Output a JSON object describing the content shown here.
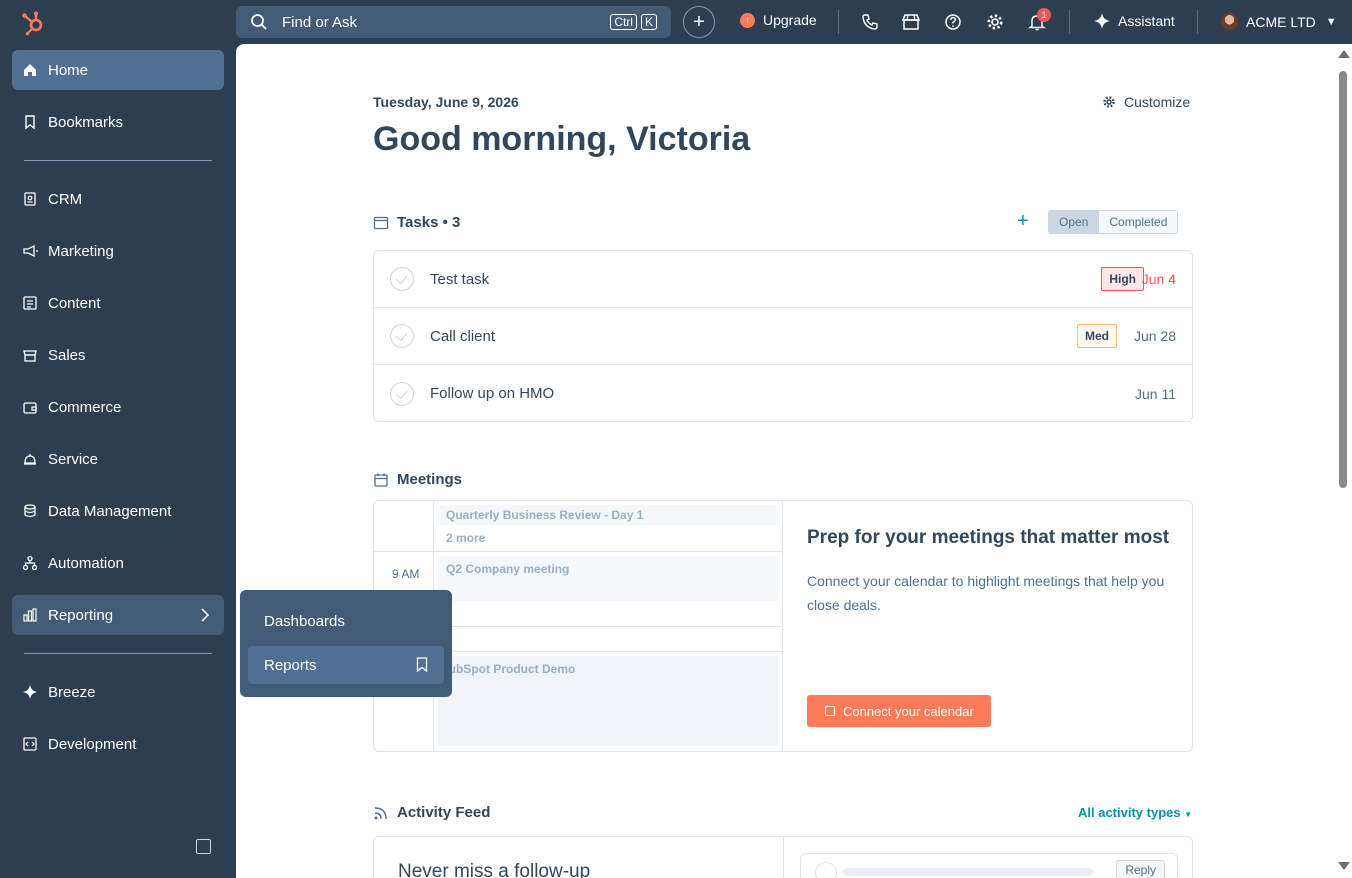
{
  "topbar": {
    "search_placeholder": "Find or Ask",
    "shortcut_keys": [
      "Ctrl",
      "K"
    ],
    "upgrade_label": "Upgrade",
    "notification_count": "1",
    "assistant_label": "Assistant",
    "account_name": "ACME LTD"
  },
  "sidebar": {
    "items": [
      {
        "label": "Home",
        "icon": "home-icon"
      },
      {
        "label": "Bookmarks",
        "icon": "bookmark-icon"
      },
      {
        "label": "CRM",
        "icon": "crm-icon"
      },
      {
        "label": "Marketing",
        "icon": "megaphone-icon"
      },
      {
        "label": "Content",
        "icon": "content-icon"
      },
      {
        "label": "Sales",
        "icon": "sales-icon"
      },
      {
        "label": "Commerce",
        "icon": "wallet-icon"
      },
      {
        "label": "Service",
        "icon": "service-bell-icon"
      },
      {
        "label": "Data Management",
        "icon": "database-icon"
      },
      {
        "label": "Automation",
        "icon": "automation-icon"
      },
      {
        "label": "Reporting",
        "icon": "bar-chart-icon"
      },
      {
        "label": "Breeze",
        "icon": "sparkle-icon"
      },
      {
        "label": "Development",
        "icon": "code-icon"
      }
    ]
  },
  "flyout": {
    "items": [
      {
        "label": "Dashboards"
      },
      {
        "label": "Reports"
      }
    ]
  },
  "main": {
    "date": "Tuesday, June 9, 2026",
    "greeting": "Good morning, Victoria",
    "customize_label": "Customize",
    "tasks": {
      "title": "Tasks • 3",
      "toggle_open": "Open",
      "toggle_completed": "Completed",
      "rows": [
        {
          "name": "Test task",
          "priority": "High",
          "due": "Jun 4"
        },
        {
          "name": "Call client",
          "priority": "Med",
          "due": "Jun 28"
        },
        {
          "name": "Follow up on HMO",
          "priority": "",
          "due": "Jun 11"
        }
      ]
    },
    "meetings": {
      "title": "Meetings",
      "events": [
        "Quarterly Business Review - Day 1",
        "Q2 Company meeting",
        "HubSpot Product Demo"
      ],
      "more_label": "2 more",
      "time_label": "9 AM",
      "prep_title": "Prep for your meetings that matter most",
      "prep_text": "Connect your calendar to highlight meetings that help you close deals.",
      "connect_label": "Connect your calendar"
    },
    "activity": {
      "title": "Activity Feed",
      "filter_label": "All activity types",
      "promo_title": "Never miss a follow-up",
      "reply_label": "Reply"
    }
  },
  "colors": {
    "sidebar_bg": "#2d3e50",
    "accent_orange": "#ff7a59",
    "link_teal": "#0091ae",
    "high_red": "#f2545b",
    "med_amber": "#f5c26b"
  }
}
